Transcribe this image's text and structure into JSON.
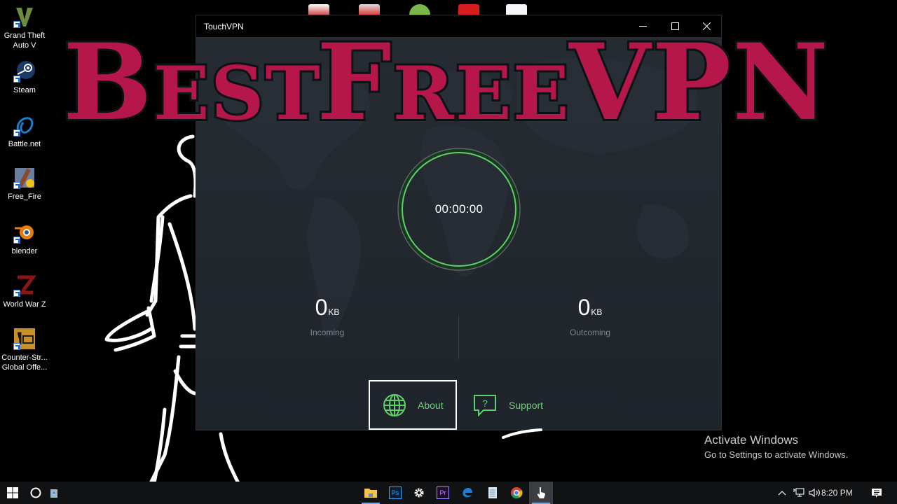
{
  "desktop": {
    "icons": [
      {
        "label": "Grand Theft\nAuto V",
        "icon": "gta-v-icon",
        "color": "#6e8a3d"
      },
      {
        "label": "Steam",
        "icon": "steam-icon",
        "color": "#1b2c4a"
      },
      {
        "label": "Battle.net",
        "icon": "battlenet-icon",
        "color": "#1a7fd0"
      },
      {
        "label": "Free_Fire",
        "icon": "free-fire-icon",
        "color": "#8a7a60"
      },
      {
        "label": "blender",
        "icon": "blender-icon",
        "color": "#e87d0d"
      },
      {
        "label": "World War Z",
        "icon": "world-war-z-icon",
        "color": "#8b1414"
      },
      {
        "label": "Counter-Str...\nGlobal Offe...",
        "icon": "csgo-icon",
        "color": "#c7902b"
      }
    ]
  },
  "headline": {
    "words": [
      "Best",
      "Free",
      "VPN"
    ],
    "color": "#b5174a"
  },
  "window": {
    "title": "TouchVPN",
    "controls": {
      "minimize": "minimize",
      "maximize": "maximize",
      "close": "close"
    },
    "timer": "00:00:00",
    "accent": "#5fd06b",
    "incoming": {
      "value": "0",
      "unit": "KB",
      "label": "Incoming"
    },
    "outgoing": {
      "value": "0",
      "unit": "KB",
      "label": "Outcoming"
    },
    "nav": [
      {
        "label": "About",
        "icon": "globe-icon",
        "selected": true
      },
      {
        "label": "Support",
        "icon": "help-chat-icon",
        "selected": false
      }
    ]
  },
  "watermark": {
    "title": "Activate Windows",
    "subtitle": "Go to Settings to activate Windows."
  },
  "taskbar": {
    "start": "start-button",
    "search": "cortana-button",
    "pinned": [
      "file-explorer",
      "photoshop",
      "settings",
      "premiere-pro",
      "edge",
      "notepad",
      "chrome",
      "touchvpn"
    ],
    "photoshop_text": "Ps",
    "premiere_text": "Pr",
    "clock": "8:20 PM"
  }
}
